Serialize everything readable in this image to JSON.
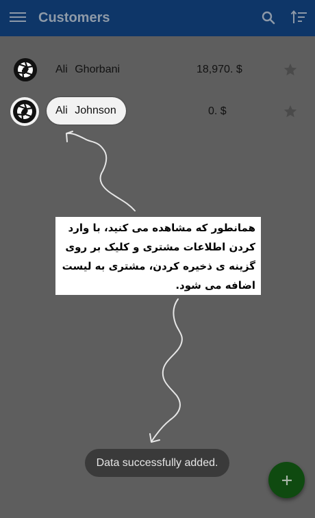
{
  "appbar": {
    "title": "Customers",
    "icons": [
      "menu-icon",
      "search-icon",
      "sort-icon"
    ]
  },
  "customers": [
    {
      "name": "Ali   Ghorbani",
      "amount": "18,970. $",
      "avatar": "camera-aperture-icon",
      "favorite": false
    },
    {
      "name": "Ali   Johnson",
      "amount": "0. $",
      "avatar": "camera-aperture-icon",
      "favorite": false
    }
  ],
  "annotation": {
    "text": "همانطور که مشاهده می کنید، با وارد کردن اطلاعات مشتری و کلیک بر روی گزینه ی ذخیره کردن، مشتری به لیست اضافه می شود."
  },
  "toast": {
    "message": "Data successfully added."
  },
  "fab": {
    "icon": "plus-icon"
  },
  "colors": {
    "appbar": "#0e3668",
    "fab": "#0f4a10",
    "overlay": "#5e5e5e"
  }
}
